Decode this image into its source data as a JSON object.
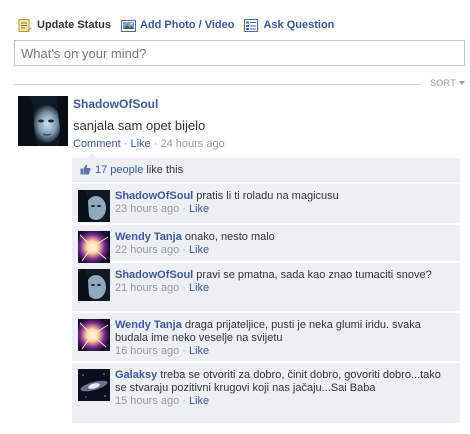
{
  "composer": {
    "tabs": [
      {
        "label": "Update Status",
        "icon": "status-icon"
      },
      {
        "label": "Add Photo / Video",
        "icon": "photo-icon"
      },
      {
        "label": "Ask Question",
        "icon": "question-icon"
      }
    ],
    "placeholder": "What's on your mind?"
  },
  "feed": {
    "sort_label": "SORT"
  },
  "post": {
    "author": "ShadowOfSoul",
    "text": "sanjala sam opet bijelo",
    "actions": {
      "comment": "Comment",
      "like": "Like",
      "separator": "·",
      "time": "24 hours ago"
    },
    "likes": {
      "count_link": "17 people",
      "suffix": "like this"
    }
  },
  "comments": [
    {
      "author": "ShadowOfSoul",
      "text": "pratis li ti roladu na magicusu",
      "time": "23 hours ago",
      "like": "Like",
      "avatar": "dark-face"
    },
    {
      "author": "Wendy Tanja",
      "text": "onako, nesto malo",
      "time": "22 hours ago",
      "like": "Like",
      "avatar": "light-burst"
    },
    {
      "author": "ShadowOfSoul",
      "text": "pravi se pmatna, sada kao znao tumaciti snove?",
      "time": "21 hours ago",
      "like": "Like",
      "avatar": "dark-face"
    },
    {
      "author": "Wendy Tanja",
      "text": "draga prijateljice, pusti je neka glumi iridu. svaka budala ime neko veselje na svijetu",
      "time": "16 hours ago",
      "like": "Like",
      "avatar": "light-burst"
    },
    {
      "author": "Galaksy",
      "text": "treba se otvoriti za dobro, činit dobro, govoriti dobro...tako se stvaraju pozitivni krugovi koji nas jačaju...Sai Baba",
      "time": "15 hours ago",
      "like": "Like",
      "avatar": "galaxy"
    }
  ],
  "colors": {
    "link": "#3b5998",
    "comment_bg": "#edeff4",
    "muted": "#999999"
  }
}
